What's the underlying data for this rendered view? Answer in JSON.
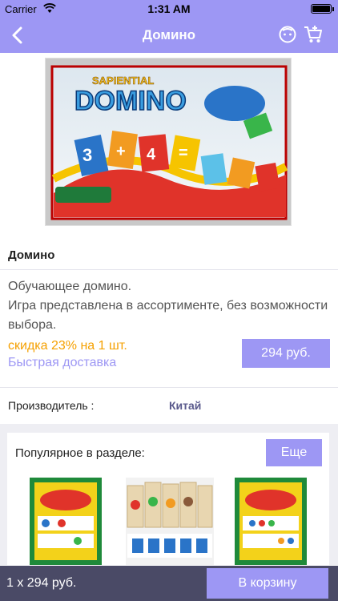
{
  "status_bar": {
    "carrier": "Carrier",
    "time": "1:31 AM"
  },
  "nav": {
    "title": "Домино",
    "back_icon": "chevron-left-icon",
    "profile_icon": "face-icon",
    "cart_icon": "cart-plus-icon"
  },
  "product": {
    "name": "Домино",
    "description": "Обучающее домино.\nИгра представлена в ассортименте, без возможности выбора.",
    "discount": "скидка 23% на 1 шт.",
    "delivery": "Быстрая доставка",
    "price": "294 руб."
  },
  "manufacturer": {
    "label": "Производитель :",
    "value": "Китай"
  },
  "popular": {
    "title": "Популярное в разделе:",
    "more_label": "Еще"
  },
  "footer": {
    "summary": "1 x 294 руб.",
    "add_to_cart": "В корзину"
  },
  "colors": {
    "accent": "#9d97f4",
    "discount": "#f5a000",
    "footer_bg": "#4a4a66"
  }
}
